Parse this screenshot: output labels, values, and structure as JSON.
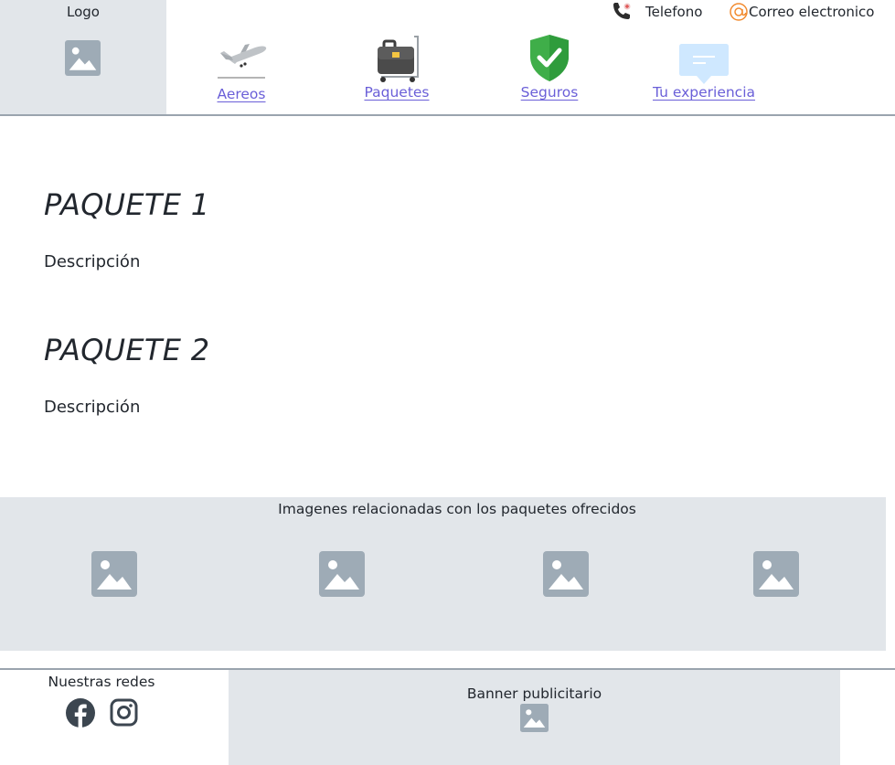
{
  "header": {
    "logo_label": "Logo",
    "phone_label": "Telefono",
    "email_label": "Correo electronico"
  },
  "nav": {
    "items": [
      {
        "label": "Aereos",
        "icon": "airplane-icon"
      },
      {
        "label": "Paquetes",
        "icon": "luggage-cart-icon"
      },
      {
        "label": "Seguros",
        "icon": "shield-check-icon"
      },
      {
        "label": "Tu experiencia",
        "icon": "chat-bubble-icon"
      }
    ]
  },
  "packages": [
    {
      "title": "PAQUETE 1",
      "description": "Descripción"
    },
    {
      "title": "PAQUETE 2",
      "description": "Descripción"
    }
  ],
  "gallery": {
    "title": "Imagenes relacionadas con los paquetes ofrecidos"
  },
  "footer": {
    "social_title": "Nuestras redes",
    "banner_title": "Banner publicitario"
  },
  "colors": {
    "link": "#6a5fd8",
    "placeholder_bg": "#e2e6ea",
    "placeholder_icon": "#9eabb6",
    "shield_green": "#3fae49",
    "email_orange": "#f28b30"
  }
}
